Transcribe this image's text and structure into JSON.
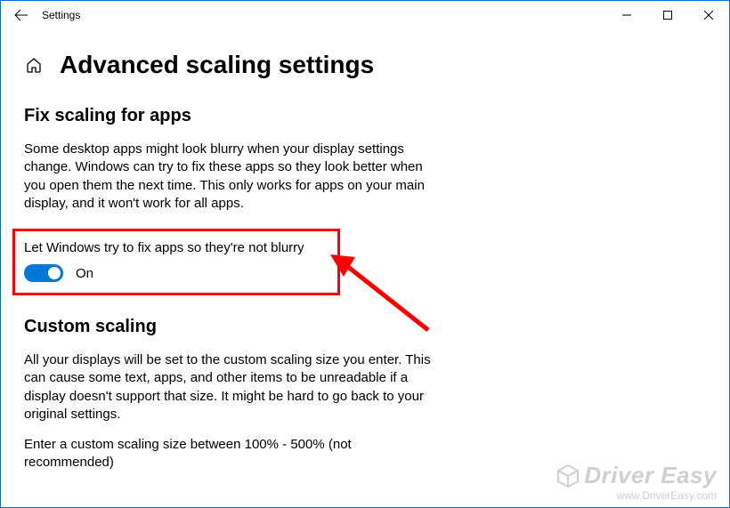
{
  "titlebar": {
    "app_name": "Settings"
  },
  "header": {
    "title": "Advanced scaling settings"
  },
  "section1": {
    "heading": "Fix scaling for apps",
    "description": "Some desktop apps might look blurry when your display settings change. Windows can try to fix these apps so they look better when you open them the next time. This only works for apps on your main display, and it won't work for all apps.",
    "toggle_label": "Let Windows try to fix apps so they're not blurry",
    "toggle_state": "On"
  },
  "section2": {
    "heading": "Custom scaling",
    "description": "All your displays will be set to the custom scaling size you enter. This can cause some text, apps, and other items to be unreadable if a display doesn't support that size. It might be hard to go back to your original settings.",
    "input_prompt": "Enter a custom scaling size between 100% - 500% (not recommended)"
  },
  "watermark": {
    "brand": "Driver Easy",
    "url": "www.DriverEasy.com"
  },
  "colors": {
    "accent": "#0078d7",
    "annotation": "#ff0000"
  }
}
